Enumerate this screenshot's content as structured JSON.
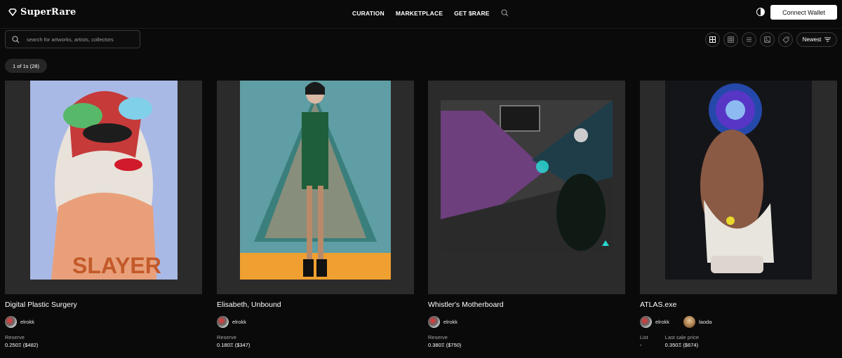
{
  "header": {
    "brand": "SuperRare",
    "nav": [
      "CURATION",
      "MARKETPLACE",
      "GET $RARE"
    ],
    "connect_label": "Connect Wallet"
  },
  "search": {
    "placeholder": "search for artworks, artists, collectors"
  },
  "toolbar": {
    "sort_label": "Newest"
  },
  "results": {
    "count_label": "1 of 1s (28)"
  },
  "cards": [
    {
      "title": "Digital Plastic Surgery",
      "artist": "elrokk",
      "price_label": "Reserve",
      "price_value": "0.250Ξ ($482)"
    },
    {
      "title": "Elisabeth, Unbound",
      "artist": "elrokk",
      "price_label": "Reserve",
      "price_value": "0.180Ξ ($347)"
    },
    {
      "title": "Whistler's Motherboard",
      "artist": "elrokk",
      "price_label": "Reserve",
      "price_value": "0.380Ξ ($750)"
    },
    {
      "title": "ATLAS.exe",
      "artist": "elrokk",
      "owner": "laoda",
      "list_label": "List",
      "list_value": "-",
      "last_sale_label": "Last sale price",
      "last_sale_value": "0.350Ξ ($674)"
    }
  ],
  "icons": [
    "logo-diamond-icon",
    "search-icon",
    "theme-toggle-icon",
    "grid-large-icon",
    "grid-small-icon",
    "list-view-icon",
    "gallery-icon",
    "tag-icon",
    "sort-lines-icon"
  ]
}
